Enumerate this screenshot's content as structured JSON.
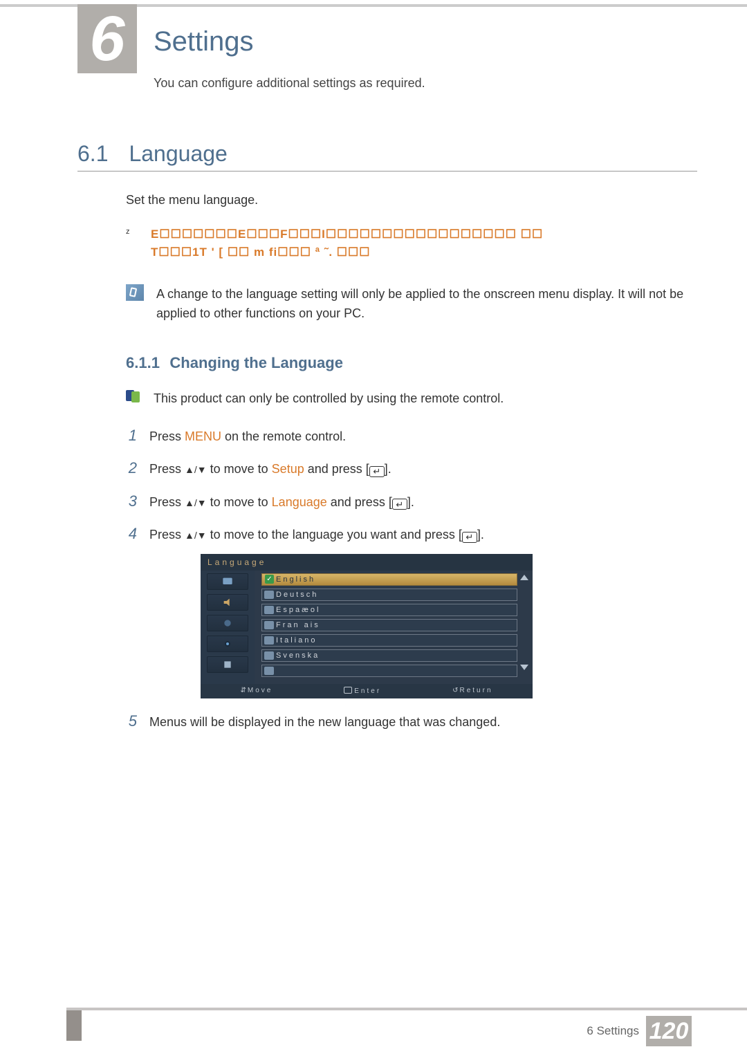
{
  "chapter": {
    "number": "6",
    "title": "Settings",
    "subtitle": "You can configure additional settings as required."
  },
  "section": {
    "number": "6.1",
    "title": "Language",
    "intro": "Set the menu language."
  },
  "orange_callout": {
    "line1": "E☐☐☐☐☐☐☐E☐☐☐F☐☐☐I☐☐☐☐☐☐☐☐☐☐☐☐☐☐☐☐☐      ☐☐",
    "line2": "T☐☐☐1T '  [ ☐☐   m fi☐☐☐ ª ˜. ☐☐☐"
  },
  "note1": "A change to the language setting will only be applied to the onscreen menu display. It will not be applied to other functions on your PC.",
  "subsection": {
    "number": "6.1.1",
    "title": "Changing the Language"
  },
  "note2": "This product can only be controlled by using the remote control.",
  "steps": {
    "s1_pre": "Press ",
    "s1_kw": "MENU",
    "s1_post": " on the remote control.",
    "s2_pre": "Press ",
    "s2_arrows": "▲/▼",
    "s2_mid": " to move to ",
    "s2_kw": "Setup",
    "s2_post": " and press [",
    "s2_close": "].",
    "s3_pre": "Press ",
    "s3_arrows": "▲/▼",
    "s3_mid": " to move to ",
    "s3_kw": "Language",
    "s3_post": " and press [",
    "s3_close": "].",
    "s4_pre": "Press ",
    "s4_arrows": "▲/▼",
    "s4_mid": " to move to the language you want and press [",
    "s4_close": "].",
    "s5": "Menus will be displayed in the new language that was changed."
  },
  "osd": {
    "title": "Language",
    "items": [
      "English",
      "Deutsch",
      "Espaæol",
      "Fran ais",
      "Italiano",
      "Svenska"
    ],
    "footer": {
      "move": "Move",
      "enter": "Enter",
      "return": "Return"
    }
  },
  "footer": {
    "chapter_label": "6 Settings",
    "page": "120"
  }
}
